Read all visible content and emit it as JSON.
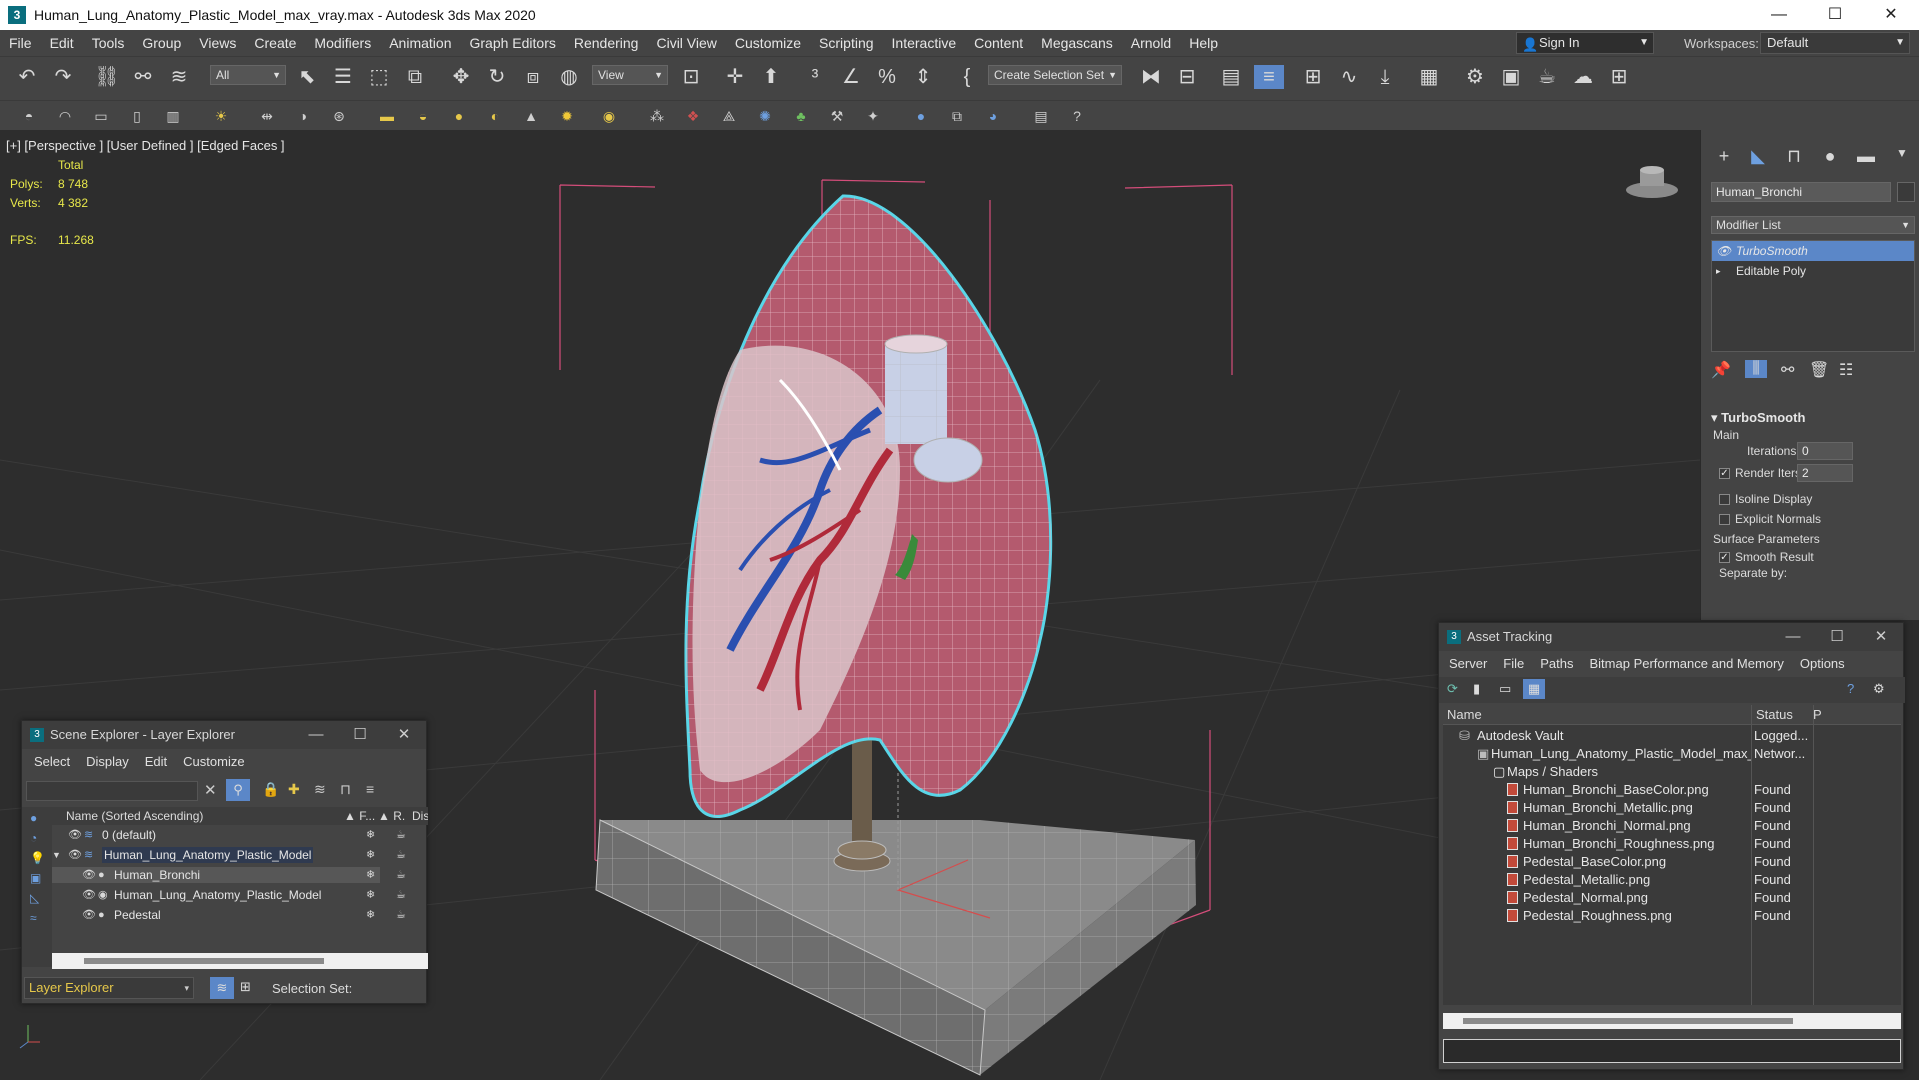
{
  "window": {
    "title": "Human_Lung_Anatomy_Plastic_Model_max_vray.max - Autodesk 3ds Max 2020",
    "minimize": "—",
    "maximize": "☐",
    "close": "✕"
  },
  "menu": [
    "File",
    "Edit",
    "Tools",
    "Group",
    "Views",
    "Create",
    "Modifiers",
    "Animation",
    "Graph Editors",
    "Rendering",
    "Civil View",
    "Customize",
    "Scripting",
    "Interactive",
    "Content",
    "Megascans",
    "Arnold",
    "Help"
  ],
  "account": {
    "signin_label": "Sign In",
    "workspaces_label": "Workspaces:",
    "workspace_value": "Default"
  },
  "toolbar": {
    "selection_filter": "All",
    "reference_coord": "View",
    "selection_set": "Create Selection Set"
  },
  "viewport": {
    "label": "[+] [Perspective ] [User Defined ] [Edged Faces ]",
    "stats_header": "Total",
    "polys_label": "Polys:",
    "polys_value": "8 748",
    "verts_label": "Verts:",
    "verts_value": "4 382",
    "fps_label": "FPS:",
    "fps_value": "11.268",
    "colors": {
      "lung": "#b45a6e",
      "selection": "#59d6e8",
      "bbox": "#d44d7a",
      "pedestal": "#8a8a8a"
    }
  },
  "command_panel": {
    "object_name": "Human_Bronchi",
    "modifier_list": "Modifier List",
    "stack": [
      "TurboSmooth",
      "Editable Poly"
    ],
    "rollout_title": "TurboSmooth",
    "main_label": "Main",
    "iterations_label": "Iterations:",
    "iterations_value": "0",
    "render_iters_label": "Render Iters:",
    "render_iters_value": "2",
    "isoline_label": "Isoline Display",
    "explicit_normals_label": "Explicit Normals",
    "surface_params_label": "Surface Parameters",
    "smooth_result_label": "Smooth Result",
    "separate_by_label": "Separate by:"
  },
  "scene_explorer": {
    "title": "Scene Explorer - Layer Explorer",
    "menu": [
      "Select",
      "Display",
      "Edit",
      "Customize"
    ],
    "col_name": "Name (Sorted Ascending)",
    "col_f": "▲ F...",
    "col_r": "▲ R...",
    "col_display": "Display",
    "rows": [
      {
        "label": "0 (default)"
      },
      {
        "label": "Human_Lung_Anatomy_Plastic_Model"
      },
      {
        "label": "Human_Bronchi"
      },
      {
        "label": "Human_Lung_Anatomy_Plastic_Model"
      },
      {
        "label": "Pedestal"
      }
    ],
    "footer_explorer": "Layer Explorer",
    "footer_selection_set": "Selection Set:"
  },
  "asset_tracking": {
    "title": "Asset Tracking",
    "menu": [
      "Server",
      "File",
      "Paths",
      "Bitmap Performance and Memory",
      "Options"
    ],
    "col_name": "Name",
    "col_status": "Status",
    "col_p": "P",
    "rows": [
      {
        "name": "Autodesk Vault",
        "status": "Logged..."
      },
      {
        "name": "Human_Lung_Anatomy_Plastic_Model_max_vray.max",
        "status": "Networ..."
      },
      {
        "name": "Maps / Shaders",
        "status": ""
      },
      {
        "name": "Human_Bronchi_BaseColor.png",
        "status": "Found"
      },
      {
        "name": "Human_Bronchi_Metallic.png",
        "status": "Found"
      },
      {
        "name": "Human_Bronchi_Normal.png",
        "status": "Found"
      },
      {
        "name": "Human_Bronchi_Roughness.png",
        "status": "Found"
      },
      {
        "name": "Pedestal_BaseColor.png",
        "status": "Found"
      },
      {
        "name": "Pedestal_Metallic.png",
        "status": "Found"
      },
      {
        "name": "Pedestal_Normal.png",
        "status": "Found"
      },
      {
        "name": "Pedestal_Roughness.png",
        "status": "Found"
      }
    ]
  }
}
